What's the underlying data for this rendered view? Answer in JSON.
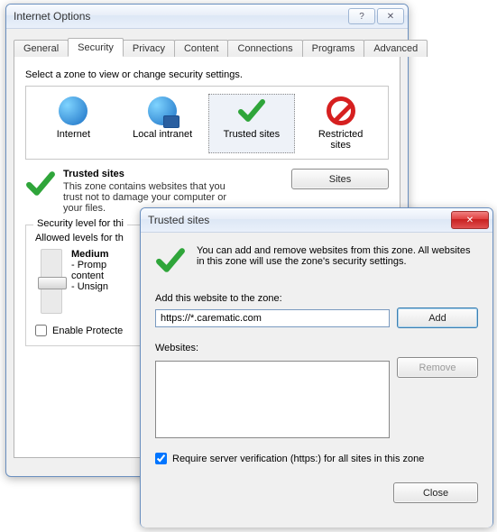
{
  "io": {
    "title": "Internet Options",
    "help_glyph": "?",
    "close_glyph": "✕",
    "tabs": {
      "general": "General",
      "security": "Security",
      "privacy": "Privacy",
      "content": "Content",
      "connections": "Connections",
      "programs": "Programs",
      "advanced": "Advanced"
    },
    "select_zone_label": "Select a zone to view or change security settings.",
    "zones": {
      "internet": "Internet",
      "local_intranet": "Local intranet",
      "trusted_sites": "Trusted sites",
      "restricted_sites": "Restricted\nsites"
    },
    "zone_desc": {
      "title": "Trusted sites",
      "body": "This zone contains websites that you trust not to damage your computer or your files."
    },
    "sites_btn": "Sites",
    "sec_level_legend": "Security level for thi",
    "allowed_levels": "Allowed levels for th",
    "level_name": "Medium",
    "level_lines": {
      "a": "- Promp",
      "b": "  content",
      "c": "- Unsign"
    },
    "enable_protected": "Enable Protecte"
  },
  "ts": {
    "title": "Trusted sites",
    "close_glyph": "✕",
    "intro": "You can add and remove websites from this zone. All websites in this zone will use the zone's security settings.",
    "add_label": "Add this website to the zone:",
    "url_value": "https://*.carematic.com",
    "add_btn": "Add",
    "websites_label": "Websites:",
    "remove_btn": "Remove",
    "verify_label": "Require server verification (https:) for all sites in this zone",
    "close_btn": "Close"
  }
}
